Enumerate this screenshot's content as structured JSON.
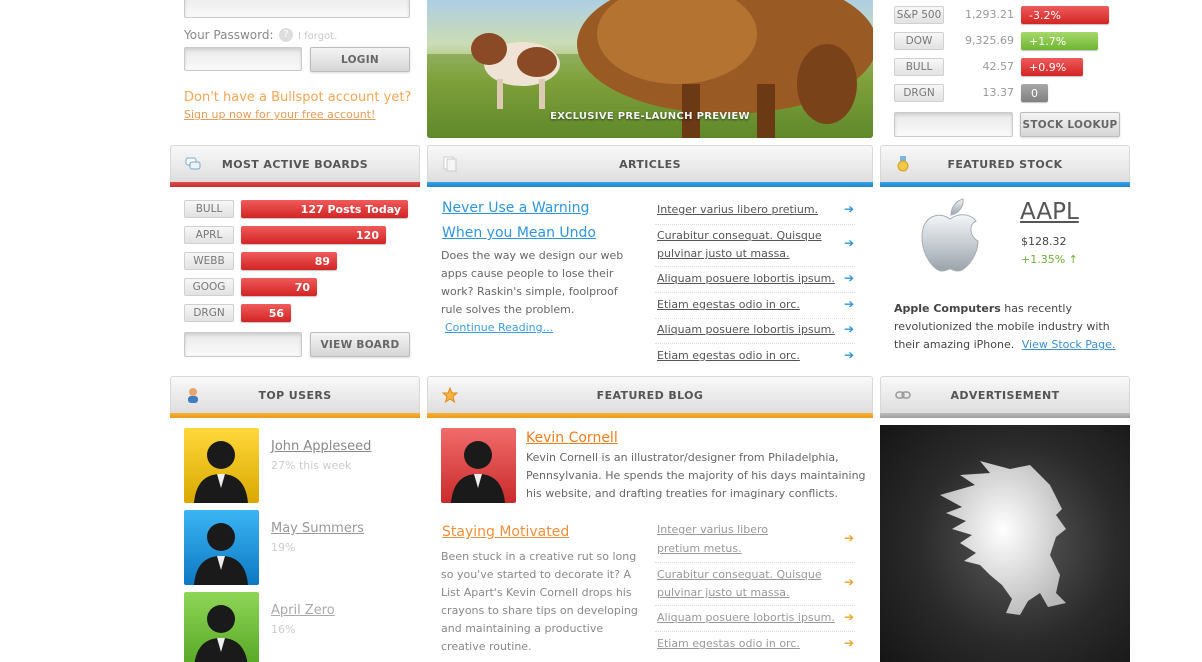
{
  "login": {
    "password_label": "Your Password:",
    "forgot_label": "I forgot.",
    "login_button": "LOGIN",
    "promo_text": "Don't have a Bullspot account yet?",
    "signup_link": "Sign up now for your free account!"
  },
  "hero": {
    "caption": "EXCLUSIVE PRE-LAUNCH PREVIEW"
  },
  "stocks": {
    "rows": [
      {
        "symbol": "S&P 500",
        "value": "1,293.21",
        "change": "-3.2%"
      },
      {
        "symbol": "DOW",
        "value": "9,325.69",
        "change": "+1.7%"
      },
      {
        "symbol": "BULL",
        "value": "42.57",
        "change": "+0.9%"
      },
      {
        "symbol": "DRGN",
        "value": "13.37",
        "change": "0"
      }
    ],
    "lookup_button": "STOCK LOOKUP"
  },
  "boards": {
    "title": "MOST ACTIVE BOARDS",
    "rows": [
      {
        "symbol": "BULL",
        "posts": "127 Posts Today"
      },
      {
        "symbol": "APRL",
        "posts": "120"
      },
      {
        "symbol": "WEBB",
        "posts": "89"
      },
      {
        "symbol": "GOOG",
        "posts": "70"
      },
      {
        "symbol": "DRGN",
        "posts": "56"
      }
    ],
    "view_button": "VIEW BOARD"
  },
  "articles": {
    "title": "ARTICLES",
    "feature_title_line1": "Never Use a Warning",
    "feature_title_line2": "When you Mean Undo",
    "feature_line1": "Does the way we design our web",
    "feature_line2": "apps cause people to lose their",
    "feature_line3": "work? Raskin's simple, foolproof",
    "feature_line4": "rule solves the problem.",
    "continue_link": "Continue Reading...",
    "item1": "Integer varius libero pretium.",
    "item2_line1": "Curabitur consequat. Quisque",
    "item2_line2": "pulvinar justo ut massa.",
    "item3": "Aliquam posuere lobortis ipsum.",
    "item4": "Etiam egestas odio in orc.",
    "item5": "Aliquam posuere lobortis ipsum.",
    "item6": "Etiam egestas odio in orc."
  },
  "featured_stock": {
    "title": "FEATURED STOCK",
    "symbol": "AAPL",
    "price": "$128.32",
    "change": "+1.35% ↑",
    "company": "Apple Computers",
    "desc_line1_rest": " has recently",
    "desc_line2": "revolutionized the mobile industry with",
    "desc_line3": "their amazing iPhone.",
    "view_link": "View Stock Page."
  },
  "top_users": {
    "title": "TOP USERS",
    "users": [
      {
        "name": "John Appleseed",
        "stat": "27% this week",
        "color": "#f2c200"
      },
      {
        "name": "May Summers",
        "stat": "19%",
        "color": "#1f9be0"
      },
      {
        "name": "April Zero",
        "stat": "16%",
        "color": "#6cc13a"
      }
    ]
  },
  "featured_blog": {
    "title": "FEATURED BLOG",
    "author": "Kevin Cornell",
    "bio_line1": "Kevin Cornell is an illustrator/designer from Philadelphia,",
    "bio_line2": "Pennsylvania. He spends the majority of his days maintaining",
    "bio_line3": "his website, and drafting treaties for imaginary conflicts.",
    "post_title": "Staying Motivated",
    "post_line1": "Been stuck in a creative rut so long",
    "post_line2": "so you've started to decorate it? A",
    "post_line3": "List Apart's Kevin Cornell drops his",
    "post_line4": "crayons to share tips on developing",
    "post_line5": "and maintaining a productive",
    "post_line6": "creative routine.",
    "item1_line1": "Integer varius libero",
    "item1_line2": "pretium metus.",
    "item2_line1": "Curabitur consequat. Quisque",
    "item2_line2": "pulvinar justo ut massa.",
    "item3": "Aliquam posuere lobortis ipsum.",
    "item4": "Etiam egestas odio in orc."
  },
  "advertisement": {
    "title": "ADVERTISEMENT"
  },
  "colors": {
    "red": "#d92d2d",
    "green": "#79bd3b",
    "blue": "#2f95dc",
    "orange": "#f0a32a"
  },
  "icons": [
    "question-icon",
    "chat-bubbles-icon",
    "documents-icon",
    "medal-icon",
    "user-icon",
    "star-icon",
    "link-icon",
    "apple-logo-icon",
    "arrow-right-icon",
    "griffin-icon"
  ]
}
